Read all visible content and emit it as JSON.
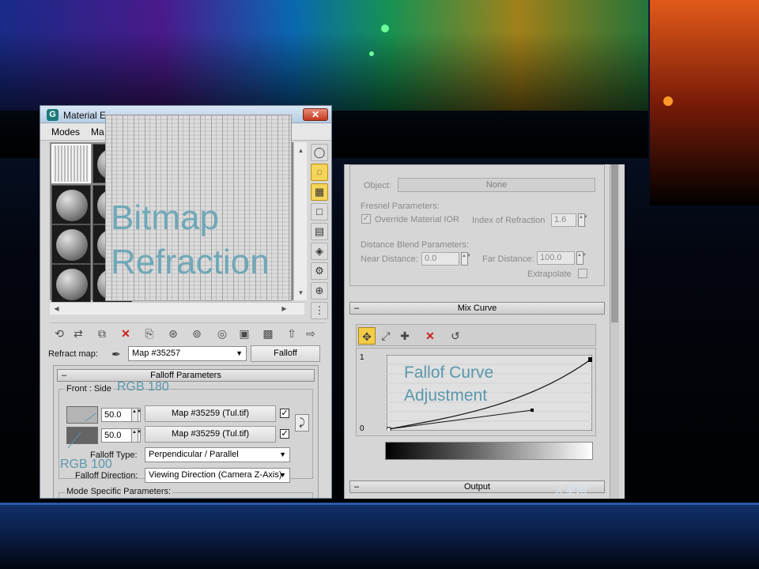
{
  "left_window": {
    "title": "Material E",
    "close_glyph": "✕",
    "menu": [
      "Modes",
      "Ma"
    ],
    "preview_labels": [
      "Bitmap",
      "Refraction"
    ],
    "refract_label": "Refract map:",
    "refract_map_value": "Map #35257",
    "falloff_button": "Falloff",
    "rollout_title": "Falloff Parameters",
    "front_side_label": "Front : Side",
    "row1": {
      "amount": "50.0",
      "map": "Map #35259 (Tul.tif)",
      "checked": true
    },
    "row2": {
      "amount": "50.0",
      "map": "Map #35259 (Tul.tif)",
      "checked": true
    },
    "falloff_type_label": "Falloff Type:",
    "falloff_type_value": "Perpendicular / Parallel",
    "falloff_dir_label": "Falloff Direction:",
    "falloff_dir_value": "Viewing Direction (Camera Z-Axis)",
    "mode_specific_label": "Mode Specific Parameters:",
    "annotation_top": "RGB 180",
    "annotation_bottom": "RGB 100",
    "swatch_top_color": "#b4b4b4",
    "swatch_bottom_color": "#646464",
    "toolbar_icons": [
      "pick-icon",
      "put-to-scene-icon",
      "assign-icon",
      "delete-icon",
      "copy-icon",
      "unique-icon",
      "put-library-icon",
      "material-id-icon",
      "show-map-icon",
      "show-end-result-icon",
      "go-parent-icon",
      "go-sibling-icon"
    ]
  },
  "right_window": {
    "object_label": "Object:",
    "object_button": "None",
    "fresnel_label": "Fresnel Parameters:",
    "override_ior_label": "Override Material IOR",
    "ior_label": "Index of Refraction",
    "ior_value": "1.6",
    "distance_blend_label": "Distance Blend Parameters:",
    "near_label": "Near Distance:",
    "near_value": "0.0",
    "far_label": "Far Distance:",
    "far_value": "100.0",
    "extrapolate_label": "Extrapolate",
    "mix_curve_title": "Mix Curve",
    "curve_y_max": "1",
    "curve_y_min": "0",
    "curve_annotation": [
      "Fallof Curve",
      "Adjustment"
    ],
    "output_title": "Output"
  },
  "watermark": "火星网"
}
